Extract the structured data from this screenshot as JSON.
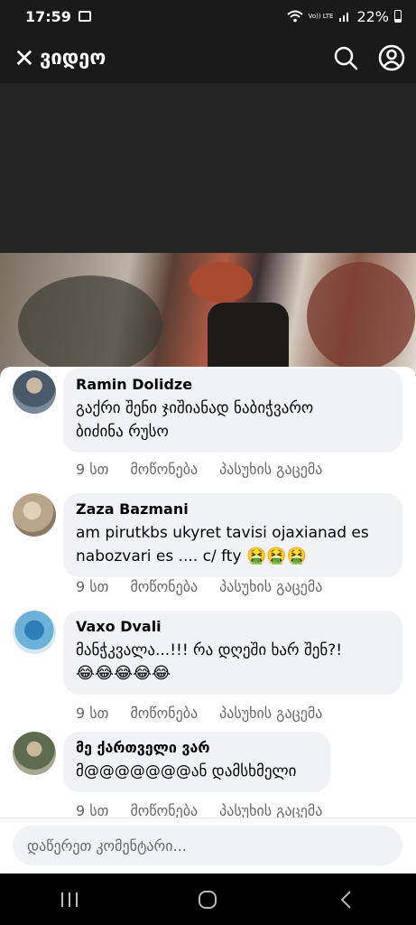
{
  "status_bar": {
    "time": "17:59",
    "lte_label": "Vo)) LTE",
    "battery": "22%"
  },
  "header": {
    "title": "ვიდეო",
    "close_icon": "close-icon",
    "search_icon": "search-icon",
    "profile_icon": "profile-icon"
  },
  "comments": [
    {
      "author": "Ramin Dolidze",
      "text": "გაქრი შენი ჯიშიანად ნაბიჭვარო\nბიძინა რუსო",
      "time": "9 სთ",
      "like": "მოწონება",
      "reply": "პასუხის გაცემა"
    },
    {
      "author": "Zaza Bazmani",
      "text": "am pirutkbs ukyret tavisi ojaxianad es\nnabozvari es .... c/ fty",
      "emoji": "🤮🤮🤮",
      "time": "9 სთ",
      "like": "მოწონება",
      "reply": "პასუხის გაცემა"
    },
    {
      "author": "Vaxo Dvali",
      "text": "მანჭკვალა...!!!  რა დღეში ხარ შენ?!",
      "emoji": "😂😂😂😂😂",
      "time": "9 სთ",
      "like": "მოწონება",
      "reply": "პასუხის გაცემა"
    },
    {
      "author": "მე ქართველი ვარ",
      "text": "მ@@@@@@@ან  დამსხმელი",
      "time": "9 სთ",
      "like": "მოწონება",
      "reply": "პასუხის გაცემა"
    }
  ],
  "composer": {
    "placeholder": "დაწერეთ კომენტარი..."
  },
  "colors": {
    "bubble": "#f0f2f5",
    "meta_text": "#65676b",
    "header_bg": "#1a1a1a"
  }
}
